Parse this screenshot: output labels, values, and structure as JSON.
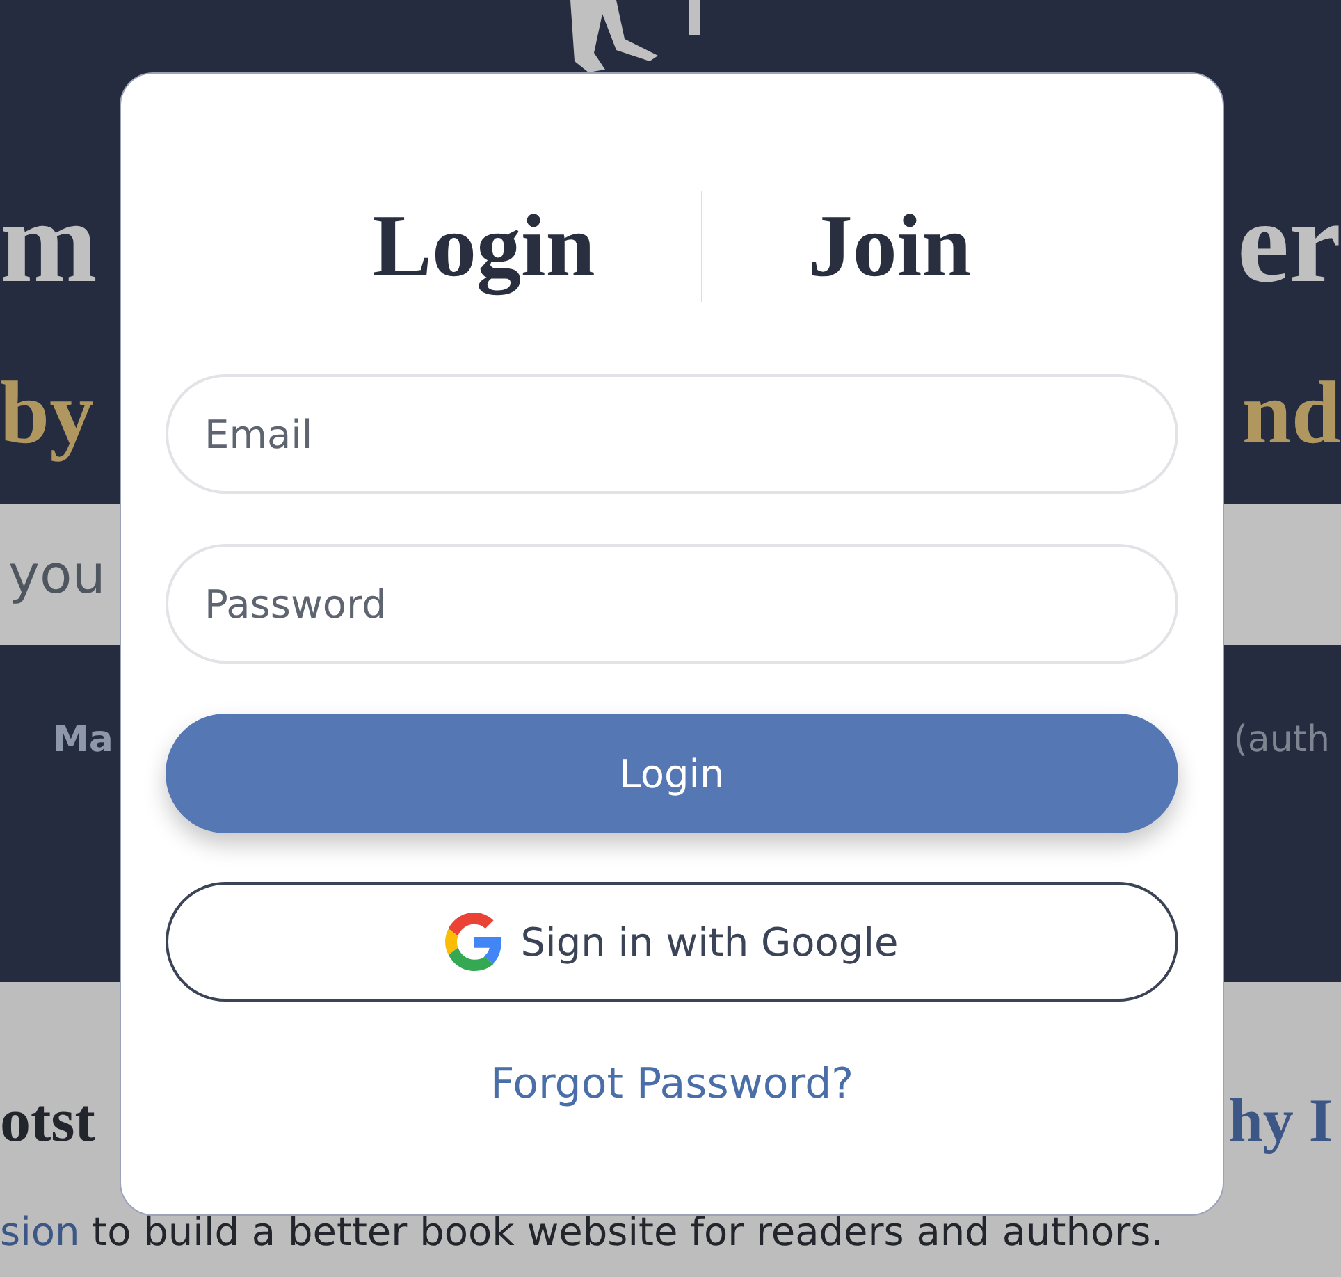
{
  "background": {
    "title_left": "m",
    "title_right": "er",
    "subtitle_left": "by",
    "subtitle_right": "nd",
    "search_text": "you",
    "nav_left": "Ma",
    "nav_right": "(auth",
    "heading_left": "otst",
    "heading_right_link": "hy I",
    "body_link": "sion",
    "body_text": " to build a better book website for readers and authors."
  },
  "dialog": {
    "tabs": [
      {
        "label": "Login"
      },
      {
        "label": "Join"
      }
    ],
    "email": {
      "placeholder": "Email"
    },
    "password": {
      "placeholder": "Password"
    },
    "login_button": "Login",
    "google_button": "Sign in with Google",
    "forgot_link": "Forgot Password?"
  }
}
